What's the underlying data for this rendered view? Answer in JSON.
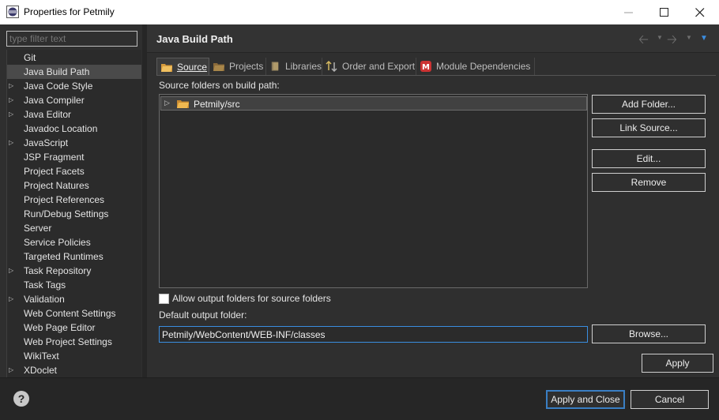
{
  "window": {
    "title": "Properties for Petmily"
  },
  "filter": {
    "placeholder": "type filter text"
  },
  "tree": {
    "items": [
      {
        "label": "Git",
        "expandable": false,
        "selected": false
      },
      {
        "label": "Java Build Path",
        "expandable": false,
        "selected": true
      },
      {
        "label": "Java Code Style",
        "expandable": true,
        "selected": false
      },
      {
        "label": "Java Compiler",
        "expandable": true,
        "selected": false
      },
      {
        "label": "Java Editor",
        "expandable": true,
        "selected": false
      },
      {
        "label": "Javadoc Location",
        "expandable": false,
        "selected": false
      },
      {
        "label": "JavaScript",
        "expandable": true,
        "selected": false
      },
      {
        "label": "JSP Fragment",
        "expandable": false,
        "selected": false
      },
      {
        "label": "Project Facets",
        "expandable": false,
        "selected": false
      },
      {
        "label": "Project Natures",
        "expandable": false,
        "selected": false
      },
      {
        "label": "Project References",
        "expandable": false,
        "selected": false
      },
      {
        "label": "Run/Debug Settings",
        "expandable": false,
        "selected": false
      },
      {
        "label": "Server",
        "expandable": false,
        "selected": false
      },
      {
        "label": "Service Policies",
        "expandable": false,
        "selected": false
      },
      {
        "label": "Targeted Runtimes",
        "expandable": false,
        "selected": false
      },
      {
        "label": "Task Repository",
        "expandable": true,
        "selected": false
      },
      {
        "label": "Task Tags",
        "expandable": false,
        "selected": false
      },
      {
        "label": "Validation",
        "expandable": true,
        "selected": false
      },
      {
        "label": "Web Content Settings",
        "expandable": false,
        "selected": false
      },
      {
        "label": "Web Page Editor",
        "expandable": false,
        "selected": false
      },
      {
        "label": "Web Project Settings",
        "expandable": false,
        "selected": false
      },
      {
        "label": "WikiText",
        "expandable": false,
        "selected": false
      },
      {
        "label": "XDoclet",
        "expandable": true,
        "selected": false
      }
    ]
  },
  "page": {
    "title": "Java Build Path",
    "tabs": [
      {
        "label": "Source",
        "active": true
      },
      {
        "label": "Projects",
        "active": false
      },
      {
        "label": "Libraries",
        "active": false
      },
      {
        "label": "Order and Export",
        "active": false
      },
      {
        "label": "Module Dependencies",
        "active": false
      }
    ],
    "source_label": "Source folders on build path:",
    "source_folders": [
      "Petmily/src"
    ],
    "buttons": {
      "add_folder": "Add Folder...",
      "link_source": "Link Source...",
      "edit": "Edit...",
      "remove": "Remove",
      "browse": "Browse...",
      "apply": "Apply"
    },
    "allow_output_label": "Allow output folders for source folders",
    "allow_output_checked": false,
    "default_output_label": "Default output folder:",
    "default_output_value": "Petmily/WebContent/WEB-INF/classes"
  },
  "footer": {
    "apply_close": "Apply and Close",
    "cancel": "Cancel"
  },
  "colors": {
    "accent": "#3a8ee0",
    "background": "#2f2f2f"
  }
}
